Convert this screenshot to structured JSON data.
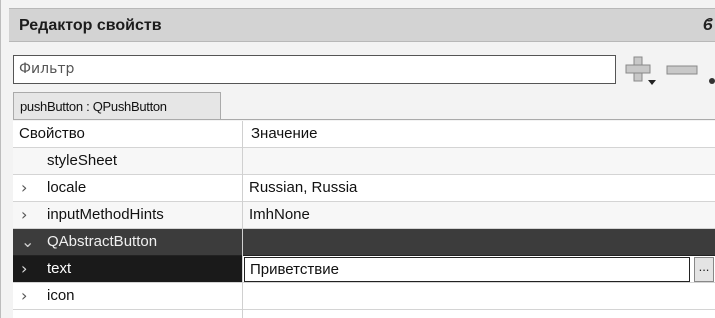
{
  "panel": {
    "title": "Редактор свойств",
    "float_icon": "ϐ"
  },
  "filter": {
    "placeholder": "Фильтр",
    "value": ""
  },
  "toolbar": {
    "add_icon": "plus-dropdown-icon",
    "remove_icon": "minus-icon"
  },
  "object_tab": {
    "label": "pushButton : QPushButton"
  },
  "table": {
    "headers": {
      "property": "Свойство",
      "value": "Значение"
    },
    "rows": [
      {
        "name": "styleSheet",
        "value": "",
        "expandable": false
      },
      {
        "name": "locale",
        "value": "Russian, Russia",
        "expandable": true
      },
      {
        "name": "inputMethodHints",
        "value": "ImhNone",
        "expandable": true
      },
      {
        "name": "QAbstractButton",
        "value": "",
        "group": true
      },
      {
        "name": "text",
        "value": "Приветствие",
        "expandable": true,
        "selected": true,
        "browse_label": "..."
      },
      {
        "name": "icon",
        "value": "",
        "expandable": true
      }
    ]
  },
  "colors": {
    "group_row": "#3c3c3c",
    "selected_name": "#1a1a1a",
    "title_bar": "#d3d3d3"
  }
}
